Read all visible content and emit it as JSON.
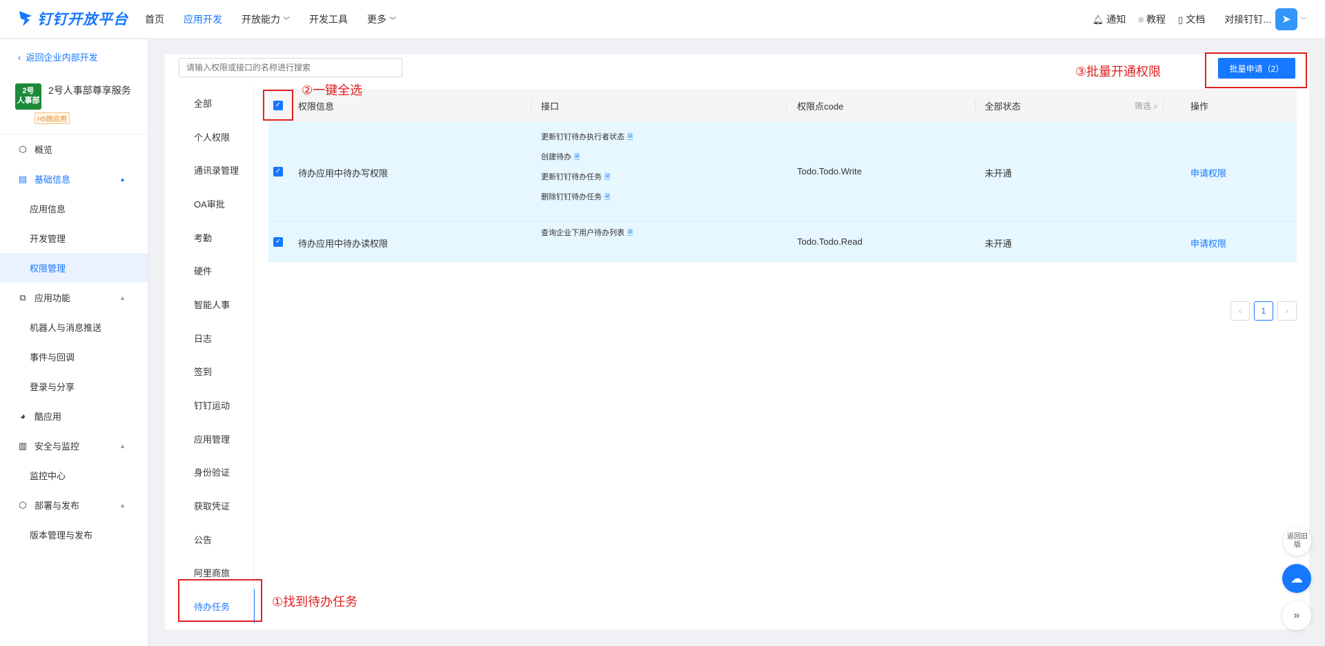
{
  "header": {
    "logo_text": "钉钉开放平台",
    "nav": [
      "首页",
      "应用开发",
      "开放能力",
      "开发工具",
      "更多"
    ],
    "right": {
      "notify": "通知",
      "tutorial": "教程",
      "docs": "文档",
      "user": "对接钉钉..."
    }
  },
  "sidebar": {
    "back": "返回企业内部开发",
    "app_logo_text": "2号人事部",
    "app_name": "2号人事部尊享服务",
    "app_tag": "H5微应用",
    "items": [
      {
        "label": "概览"
      },
      {
        "label": "基础信息"
      },
      {
        "label": "应用信息"
      },
      {
        "label": "开发管理"
      },
      {
        "label": "权限管理"
      },
      {
        "label": "应用功能"
      },
      {
        "label": "机器人与消息推送"
      },
      {
        "label": "事件与回调"
      },
      {
        "label": "登录与分享"
      },
      {
        "label": "酷应用"
      },
      {
        "label": "安全与监控"
      },
      {
        "label": "监控中心"
      },
      {
        "label": "部署与发布"
      },
      {
        "label": "版本管理与发布"
      }
    ]
  },
  "main": {
    "search_placeholder": "请输入权限或接口的名称进行搜索",
    "batch_button": "批量申请（2）",
    "categories": [
      "全部",
      "个人权限",
      "通讯录管理",
      "OA审批",
      "考勤",
      "硬件",
      "智能人事",
      "日志",
      "签到",
      "钉钉运动",
      "应用管理",
      "身份验证",
      "获取凭证",
      "公告",
      "阿里商旅",
      "待办任务"
    ],
    "table": {
      "headers": {
        "perm": "权限信息",
        "api": "接口",
        "code": "权限点code",
        "status": "全部状态",
        "filter": "筛选",
        "op": "操作"
      },
      "rows": [
        {
          "perm": "待办应用中待办写权限",
          "apis": [
            "更新钉钉待办执行者状态",
            "创建待办",
            "更新钉钉待办任务",
            "删除钉钉待办任务"
          ],
          "code": "Todo.Todo.Write",
          "status": "未开通",
          "op": "申请权限"
        },
        {
          "perm": "待办应用中待办读权限",
          "apis": [
            "查询企业下用户待办列表"
          ],
          "code": "Todo.Todo.Read",
          "status": "未开通",
          "op": "申请权限"
        }
      ]
    },
    "pager": {
      "current": "1"
    }
  },
  "annotations": {
    "a1": "①找到待办任务",
    "a2": "②一键全选",
    "a3": "③批量开通权限"
  },
  "floating": {
    "old": "返回旧版"
  }
}
